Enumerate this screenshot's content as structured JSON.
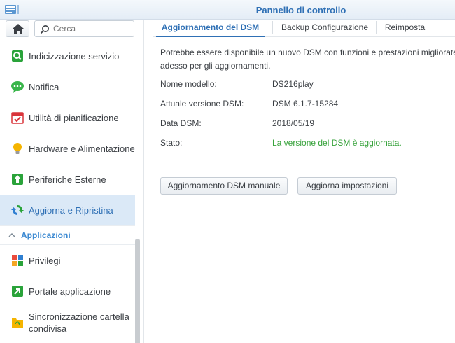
{
  "window": {
    "title": "Pannello di controllo"
  },
  "sidebar": {
    "search_placeholder": "Cerca",
    "items": [
      {
        "label": "Indicizzazione servizio",
        "icon": "index-service-icon"
      },
      {
        "label": "Notifica",
        "icon": "notification-icon"
      },
      {
        "label": "Utilità di pianificazione",
        "icon": "task-scheduler-icon"
      },
      {
        "label": "Hardware e Alimentazione",
        "icon": "hardware-power-icon"
      },
      {
        "label": "Periferiche Esterne",
        "icon": "external-devices-icon"
      },
      {
        "label": "Aggiorna e Ripristina",
        "icon": "update-restore-icon",
        "selected": true
      }
    ],
    "section": {
      "label": "Applicazioni"
    },
    "app_items": [
      {
        "label": "Privilegi",
        "icon": "privileges-icon"
      },
      {
        "label": "Portale applicazione",
        "icon": "application-portal-icon"
      },
      {
        "label": "Sincronizzazione cartella condivisa",
        "icon": "shared-folder-sync-icon"
      }
    ]
  },
  "tabs": [
    {
      "label": "Aggiornamento del DSM",
      "active": true
    },
    {
      "label": "Backup Configurazione"
    },
    {
      "label": "Reimposta"
    }
  ],
  "main": {
    "intro_line1": "Potrebbe essere disponibile un nuovo DSM con funzioni e prestazioni migliorate. Cont",
    "intro_line2": "adesso per gli aggiornamenti.",
    "fields": [
      {
        "label": "Nome modello:",
        "value": "DS216play"
      },
      {
        "label": "Attuale versione DSM:",
        "value": "DSM 6.1.7-15284"
      },
      {
        "label": "Data DSM:",
        "value": "2018/05/19"
      },
      {
        "label": "Stato:",
        "value": "La versione del DSM è aggiornata.",
        "status": "ok"
      }
    ],
    "buttons": {
      "manual_update": "Aggiornamento DSM manuale",
      "update_settings": "Aggiorna impostazioni"
    }
  },
  "colors": {
    "accent": "#2f70b5",
    "selected_bg": "#dbe9f7",
    "status_ok": "#38a33c",
    "section": "#3d8ad2"
  }
}
